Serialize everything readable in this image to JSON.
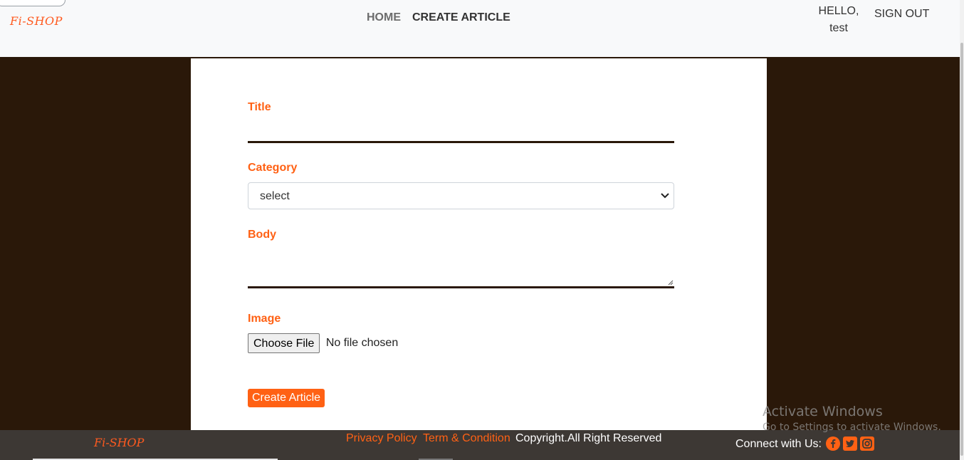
{
  "header": {
    "pill_text": "~~~~",
    "brand": "Fi-SHOP",
    "nav": {
      "home": "HOME",
      "create_article": "CREATE ARTICLE"
    },
    "user": {
      "greeting": "HELLO,",
      "name": "test"
    },
    "sign_out": "SIGN OUT"
  },
  "form": {
    "title_label": "Title",
    "title_value": "",
    "category_label": "Category",
    "category_selected": "select",
    "body_label": "Body",
    "body_value": "",
    "image_label": "Image",
    "choose_file": "Choose File",
    "file_status": "No file chosen",
    "submit": "Create Article"
  },
  "footer": {
    "brand": "Fi-SHOP",
    "privacy": "Privacy Policy",
    "terms": "Term & Condition",
    "copyright": "Copyright.All Right Reserved",
    "connect": "Connect with Us:",
    "social_icons": [
      "facebook-icon",
      "twitter-icon",
      "instagram-icon"
    ]
  },
  "watermark": {
    "title": "Activate Windows",
    "subtitle": "Go to Settings to activate Windows."
  },
  "colors": {
    "accent": "#ff6114",
    "background": "#2a1809",
    "footer": "#3d3834"
  }
}
